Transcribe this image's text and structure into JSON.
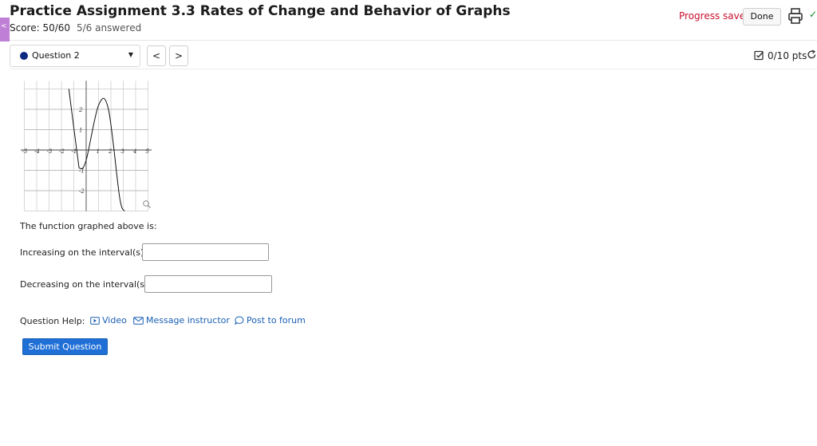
{
  "header": {
    "title": "Practice Assignment 3.3 Rates of Change and Behavior of Graphs",
    "score": "Score: 50/60",
    "answered": "5/6 answered",
    "progress_status": "Progress saved",
    "done_label": "Done",
    "side_tab_glyph": "<"
  },
  "toolbar": {
    "question_select": "Question 2",
    "prev_label": "<",
    "next_label": ">",
    "points": "0/10 pts"
  },
  "question": {
    "prompt": "The function graphed above is:",
    "increasing_label": "Increasing on the interval(s)",
    "increasing_value": "",
    "decreasing_label": "Decreasing on the interval(s)",
    "decreasing_value": ""
  },
  "help": {
    "label": "Question Help:",
    "video": "Video",
    "message": "Message instructor",
    "forum": "Post to forum"
  },
  "submit_label": "Submit Question",
  "graph": {
    "x_ticks": [
      "-5",
      "-4",
      "-3",
      "-2",
      "-1",
      "1",
      "2",
      "3",
      "4",
      "5"
    ],
    "y_ticks": [
      "2",
      "1",
      "-1",
      "-2"
    ],
    "curve_points": [
      [
        -1.4,
        3.0
      ],
      [
        -0.7,
        -0.3
      ],
      [
        -0.5,
        -0.9
      ],
      [
        0.0,
        -0.5
      ],
      [
        1.0,
        2.2
      ],
      [
        1.8,
        2.0
      ],
      [
        2.7,
        -2.3
      ],
      [
        3.1,
        -3.0
      ]
    ]
  },
  "colors": {
    "accent": "#1f6fd6",
    "progress": "#c8102e",
    "side_tab": "#c07fd6",
    "question_dot": "#0e2a80"
  },
  "icons": {
    "print": "printer-icon",
    "points": "checkbox-icon",
    "retry": "retry-icon",
    "video": "video-icon",
    "message": "mail-icon",
    "forum": "comment-icon",
    "magnify": "magnify-icon"
  }
}
